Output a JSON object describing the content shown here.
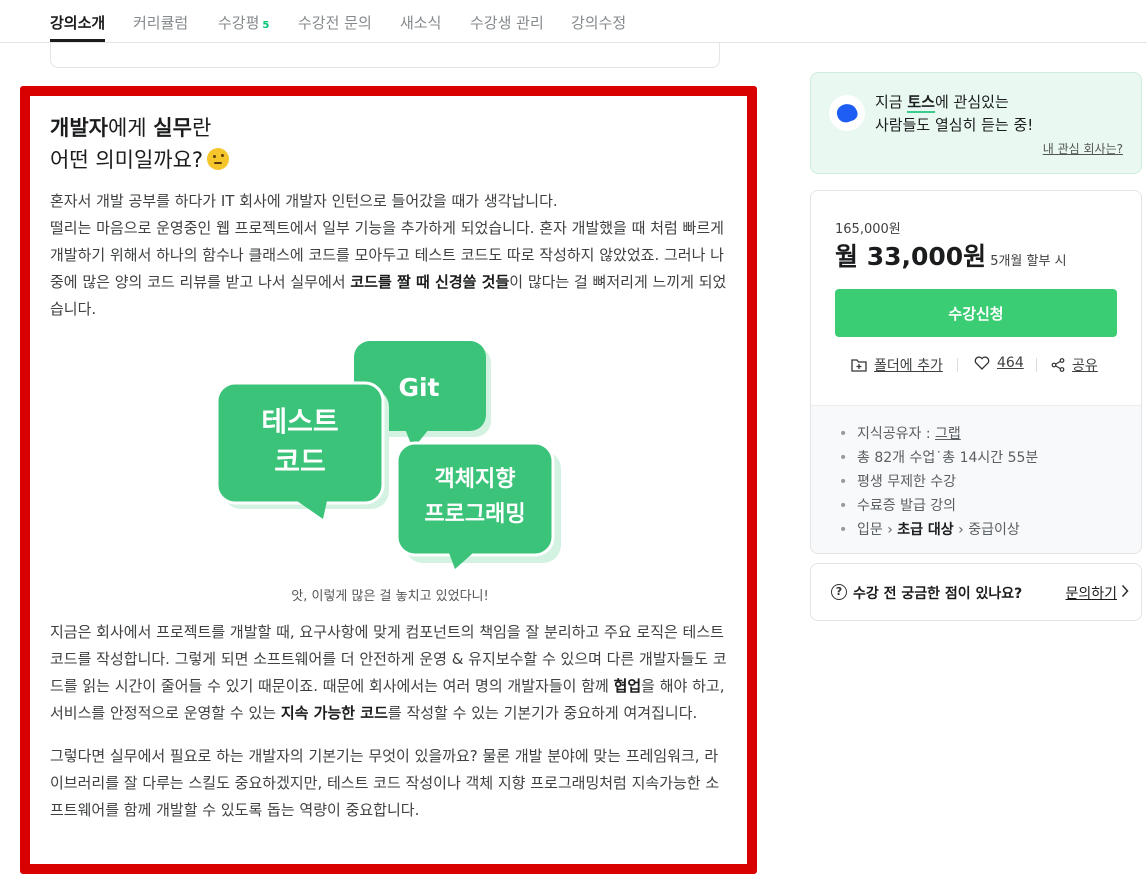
{
  "tabs": [
    {
      "label": "강의소개",
      "active": true
    },
    {
      "label": "커리큘럼"
    },
    {
      "label": "수강평",
      "count": "5"
    },
    {
      "label": "수강전 문의"
    },
    {
      "label": "새소식"
    },
    {
      "label": "수강생 관리"
    },
    {
      "label": "강의수정"
    }
  ],
  "article": {
    "headline_bold1": "개발자",
    "headline_mid": "에게 ",
    "headline_bold2": "실무",
    "headline_end": "란",
    "headline_line2": "어떤 의미일까요?",
    "emoji": "thinking-face-emoji",
    "p1_a": "혼자서 개발 공부를 하다가 IT 회사에 개발자 인턴으로 들어갔을 때가 생각납니다.",
    "p1_b": "떨리는 마음으로 운영중인 웹 프로젝트에서 일부 기능을 추가하게 되었습니다. 혼자 개발했을 때 처럼 빠르게 개발하기 위해서 하나의 함수나 클래스에 코드를 모아두고 테스트 코드도 따로 작성하지 않았었죠. 그러나 나중에 많은 양의 코드 리뷰를 받고 나서 실무에서 ",
    "p1_bold": "코드를 짤 때 신경쓸 것들",
    "p1_c": "이 많다는 걸 뼈저리게 느끼게 되었습니다.",
    "figure": {
      "bubble1": "Git",
      "bubble2_l1": "테스트",
      "bubble2_l2": "코드",
      "bubble3_l1": "객체지향",
      "bubble3_l2": "프로그래밍",
      "caption": "앗, 이렇게 많은 걸 놓치고 있었다니!",
      "color": "#3cc37a"
    },
    "p2_a": "지금은 회사에서 프로젝트를 개발할 때, 요구사항에 맞게 컴포넌트의 책임을 잘 분리하고 주요 로직은 테스트 코드를 작성합니다. 그렇게 되면 소프트웨어를 더 안전하게 운영 & 유지보수할 수 있으며 다른 개발자들도 코드를 읽는 시간이 줄어들 수 있기 때문이죠. 때문에 회사에서는 여러 명의 개발자들이 함께 ",
    "p2_bold1": "협업",
    "p2_b": "을 해야 하고, 서비스를 안정적으로 운영할 수 있는 ",
    "p2_bold2": "지속 가능한 코드",
    "p2_c": "를 작성할 수 있는 기본기가 중요하게 여겨집니다.",
    "p3": "그렇다면 실무에서 필요로 하는 개발자의 기본기는 무엇이 있을까요? 물론 개발 분야에 맞는 프레임워크, 라이브러리를 잘 다루는 스킬도 중요하겠지만, 테스트 코드 작성이나 객체 지향 프로그래밍처럼 지속가능한 소프트웨어를 함께 개발할 수 있도록 돕는 역량이 중요합니다."
  },
  "promo": {
    "line1_a": "지금 ",
    "line1_hl": "토스",
    "line1_b": "에 관심있는",
    "line2": "사람들도 열심히 듣는 중!",
    "link": "내 관심 회사는?",
    "bg": "#e9f8f1"
  },
  "price": {
    "original": "165,000원",
    "monthly": "월 33,000원",
    "installment": "5개월 할부 시",
    "enroll": "수강신청",
    "folder": "폴더에 추가",
    "likes": "464",
    "share": "공유",
    "accent": "#3acd73"
  },
  "info": {
    "sharer_label": "지식공유자 : ",
    "sharer": "그랩",
    "lessons": "총 82개 수업˙총 14시간 55분",
    "period": "평생 무제한 수강",
    "certificate": "수료증 발급 강의",
    "level_a": "입문",
    "level_b": "초급 대상",
    "level_c": "중급이상"
  },
  "question": {
    "text": "수강 전 궁금한 점이 있나요?",
    "link": "문의하기"
  }
}
